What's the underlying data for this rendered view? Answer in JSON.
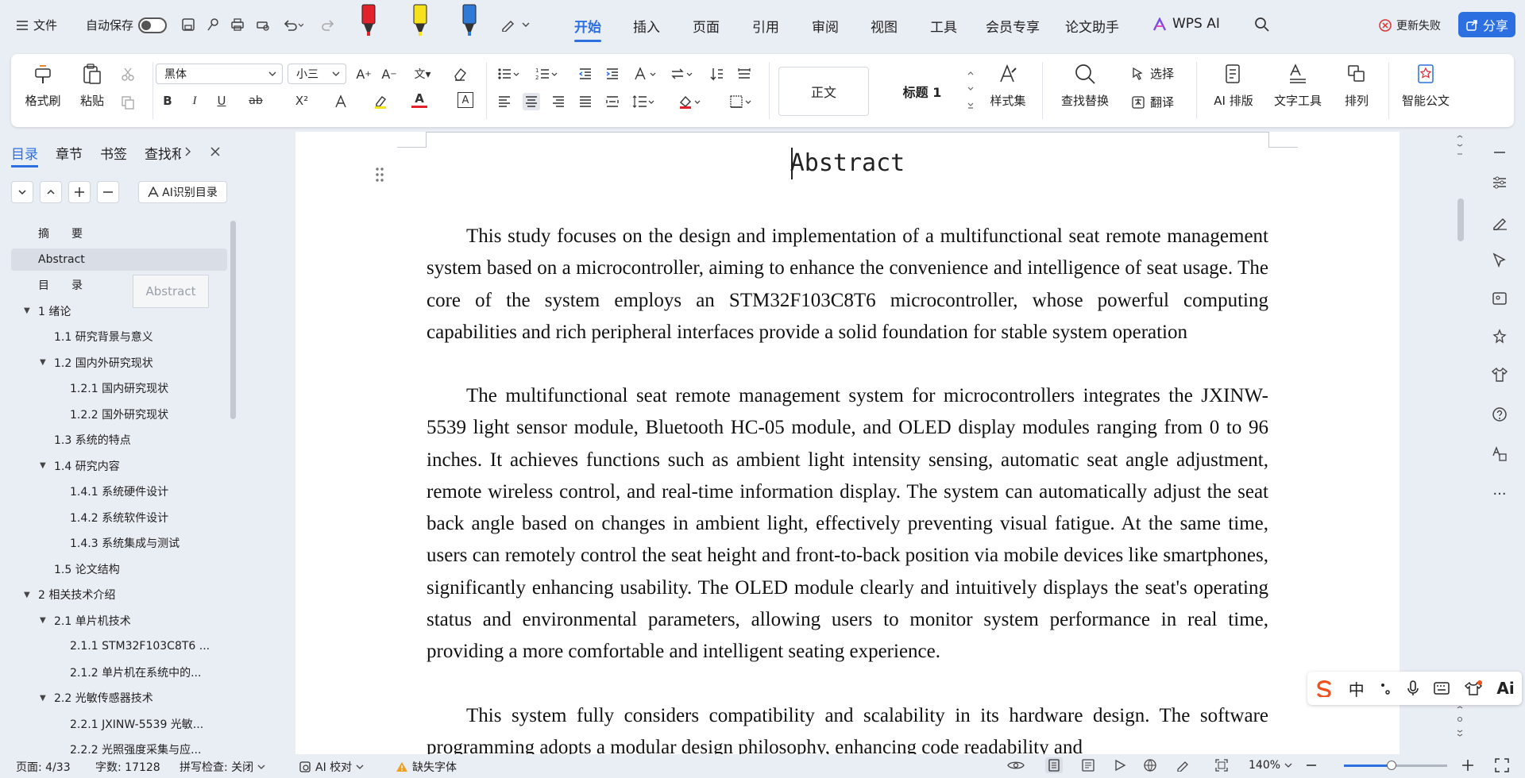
{
  "topbar": {
    "file_label": "文件",
    "autosave_label": "自动保存",
    "menu_tabs": [
      "开始",
      "插入",
      "页面",
      "引用",
      "审阅",
      "视图",
      "工具",
      "会员专享",
      "论文助手",
      "WPS AI"
    ],
    "update_failed": "更新失败",
    "share_label": "分享",
    "pen_colors": [
      "#e3232b",
      "#f5e21a",
      "#2f7ad6"
    ]
  },
  "ribbon": {
    "format_painter": "格式刷",
    "paste": "粘贴",
    "font_name": "黑体",
    "font_size": "小三",
    "style_normal": "正文",
    "style_heading": "标题 1",
    "style_set": "样式集",
    "find_replace": "查找替换",
    "select": "选择",
    "translate": "翻译",
    "ai_layout": "AI 排版",
    "text_tools": "文字工具",
    "arrange": "排列",
    "smart_doc": "智能公文",
    "bold": "B",
    "italic": "I",
    "underline": "U",
    "strike": "ab",
    "superscript": "X²",
    "font_color": "A"
  },
  "leftpanel": {
    "tabs": [
      "目录",
      "章节",
      "书签",
      "查找和"
    ],
    "ai_toc": "AI识别目录",
    "tooltip": "Abstract",
    "toc": [
      {
        "label": "摘　　要",
        "level": 0,
        "arrow": ""
      },
      {
        "label": "Abstract",
        "level": 0,
        "arrow": "",
        "selected": true
      },
      {
        "label": "目　　录",
        "level": 0,
        "arrow": ""
      },
      {
        "label": "1 绪论",
        "level": 0,
        "arrow": "▼"
      },
      {
        "label": "1.1 研究背景与意义",
        "level": 1,
        "arrow": ""
      },
      {
        "label": "1.2 国内外研究现状",
        "level": 1,
        "arrow": "▼"
      },
      {
        "label": "1.2.1 国内研究现状",
        "level": 2,
        "arrow": ""
      },
      {
        "label": "1.2.2 国外研究现状",
        "level": 2,
        "arrow": ""
      },
      {
        "label": "1.3 系统的特点",
        "level": 1,
        "arrow": ""
      },
      {
        "label": "1.4 研究内容",
        "level": 1,
        "arrow": "▼"
      },
      {
        "label": "1.4.1 系统硬件设计",
        "level": 2,
        "arrow": ""
      },
      {
        "label": "1.4.2 系统软件设计",
        "level": 2,
        "arrow": ""
      },
      {
        "label": "1.4.3 系统集成与测试",
        "level": 2,
        "arrow": ""
      },
      {
        "label": "1.5 论文结构",
        "level": 1,
        "arrow": ""
      },
      {
        "label": "2 相关技术介绍",
        "level": 0,
        "arrow": "▼"
      },
      {
        "label": "2.1 单片机技术",
        "level": 1,
        "arrow": "▼"
      },
      {
        "label": "2.1.1 STM32F103C8T6 ...",
        "level": 2,
        "arrow": ""
      },
      {
        "label": "2.1.2 单片机在系统中的...",
        "level": 2,
        "arrow": ""
      },
      {
        "label": "2.2 光敏传感器技术",
        "level": 1,
        "arrow": "▼"
      },
      {
        "label": "2.2.1 JXINW-5539 光敏...",
        "level": 2,
        "arrow": ""
      },
      {
        "label": "2.2.2 光照强度采集与应...",
        "level": 2,
        "arrow": ""
      }
    ]
  },
  "document": {
    "title": "Abstract",
    "paragraphs": [
      "This study focuses on the design and implementation of a multifunctional seat remote management system based on a microcontroller, aiming to enhance the convenience and intelligence of seat usage. The core of the system employs an STM32F103C8T6 microcontroller, whose powerful computing capabilities and rich peripheral interfaces provide a solid foundation for stable system operation",
      "The multifunctional seat remote management system for microcontrollers integrates the JXINW-5539 light sensor module, Bluetooth HC-05 module, and OLED display modules ranging from 0 to 96 inches. It achieves functions such as ambient light intensity sensing, automatic seat angle adjustment, remote wireless control, and real-time information display. The system can automatically adjust the seat back angle based on changes in ambient light, effectively preventing visual fatigue. At the same time, users can remotely control the seat height and front-to-back position via mobile devices like smartphones, significantly enhancing usability. The OLED module clearly and intuitively displays the seat's operating status and environmental parameters, allowing users to monitor system performance in real time, providing a more comfortable and intelligent seating experience.",
      "This system fully considers compatibility and scalability in its hardware design. The software programming adopts a modular design philosophy, enhancing code readability and"
    ]
  },
  "statusbar": {
    "page": "页面: 4/33",
    "words": "字数: 17128",
    "spell": "拼写检查: 关闭",
    "ai_proof": "AI 校对",
    "missing_font": "缺失字体",
    "zoom": "140%"
  },
  "ime": {
    "chinese": "中",
    "ai": "Ai"
  }
}
